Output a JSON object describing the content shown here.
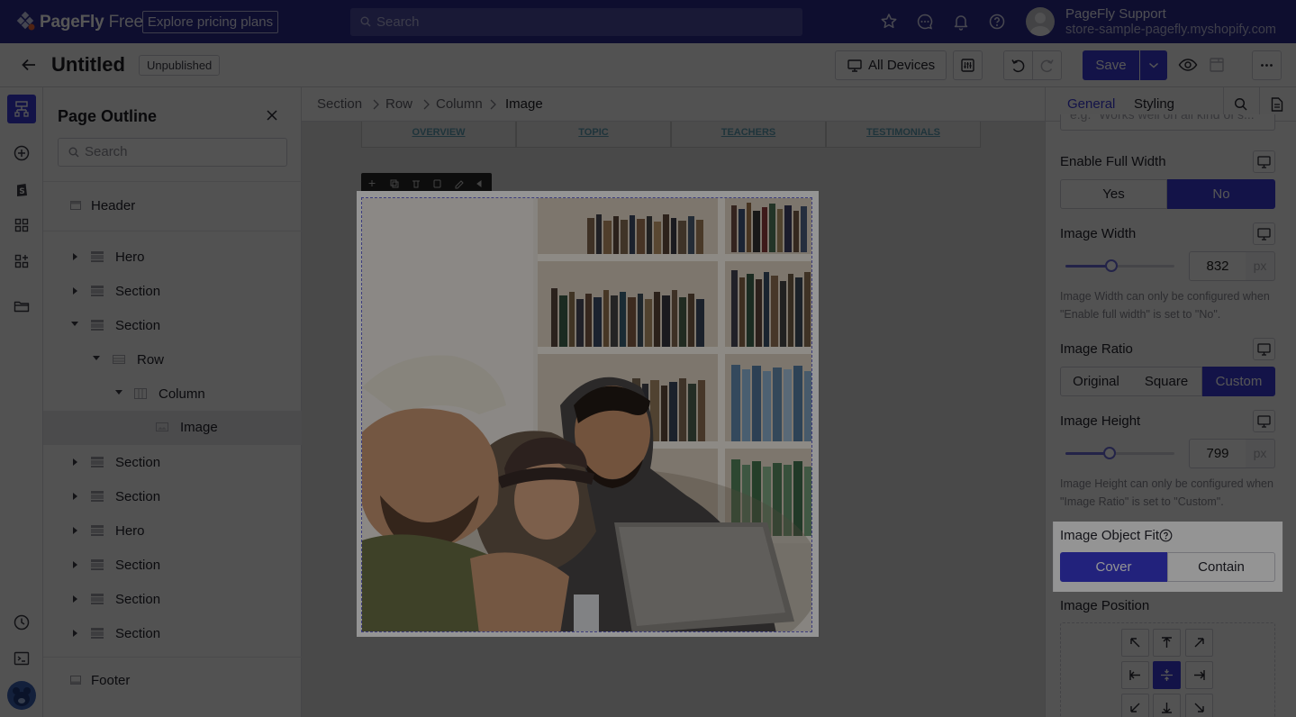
{
  "topbar": {
    "logo_text": "PageFly",
    "logo_plan": "Free",
    "pricing_label": "Explore pricing plans",
    "search_placeholder": "Search",
    "user_name": "PageFly Support",
    "user_store": "store-sample-pagefly.myshopify.com",
    "icons": [
      "star-icon",
      "chat-icon",
      "bell-icon",
      "help-icon"
    ]
  },
  "toolbar": {
    "title": "Untitled",
    "status": "Unpublished",
    "devices_label": "All Devices",
    "save_label": "Save"
  },
  "outline": {
    "title": "Page Outline",
    "search_placeholder": "Search",
    "header_label": "Header",
    "footer_label": "Footer",
    "items": [
      {
        "label": "Hero"
      },
      {
        "label": "Section"
      },
      {
        "label": "Section"
      },
      {
        "label": "Row"
      },
      {
        "label": "Column"
      },
      {
        "label": "Image"
      },
      {
        "label": "Section"
      },
      {
        "label": "Section"
      },
      {
        "label": "Hero"
      },
      {
        "label": "Section"
      },
      {
        "label": "Section"
      },
      {
        "label": "Section"
      }
    ]
  },
  "canvas": {
    "breadcrumb": [
      "Section",
      "Row",
      "Column",
      "Image"
    ],
    "nav_tabs": [
      "OVERVIEW",
      "TOPIC",
      "TEACHERS",
      "TESTIMONIALS"
    ]
  },
  "inspector": {
    "tabs": [
      "General",
      "Styling"
    ],
    "alt_placeholder": "e.g. \"Works well on all kind of s...",
    "full_width": {
      "label": "Enable Full Width",
      "options": [
        "Yes",
        "No"
      ],
      "selected": "No"
    },
    "image_width": {
      "label": "Image Width",
      "value": "832",
      "unit": "px",
      "slider": 0.42,
      "hint": "Image Width can only be configured when \"Enable full width\" is set to \"No\"."
    },
    "image_ratio": {
      "label": "Image Ratio",
      "options": [
        "Original",
        "Square",
        "Custom"
      ],
      "selected": "Custom"
    },
    "image_height": {
      "label": "Image Height",
      "value": "799",
      "unit": "px",
      "slider": 0.4,
      "hint": "Image Height can only be configured when \"Image Ratio\" is set to \"Custom\"."
    },
    "object_fit": {
      "label": "Image Object Fit",
      "options": [
        "Cover",
        "Contain"
      ],
      "selected": "Cover"
    },
    "image_position": {
      "label": "Image Position",
      "selected": "center"
    }
  },
  "colors": {
    "brand": "#2b2b8e",
    "accent": "#3b3bd6"
  }
}
